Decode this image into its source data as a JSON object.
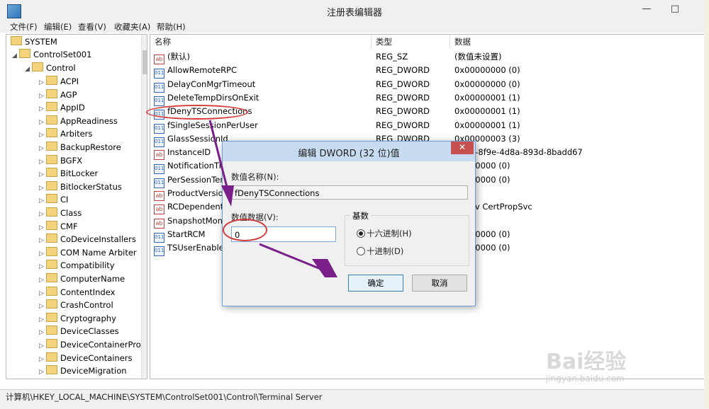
{
  "window": {
    "title": "注册表编辑器",
    "minimize": "—",
    "maximize": "□"
  },
  "menu": [
    "文件(F)",
    "编辑(E)",
    "查看(V)",
    "收藏夹(A)",
    "帮助(H)"
  ],
  "tree": {
    "root": "SYSTEM",
    "level1": "ControlSet001",
    "level2": "Control",
    "children": [
      "ACPI",
      "AGP",
      "AppID",
      "AppReadiness",
      "Arbiters",
      "BackupRestore",
      "BGFX",
      "BitLocker",
      "BitlockerStatus",
      "CI",
      "Class",
      "CMF",
      "CoDeviceInstallers",
      "COM Name Arbiter",
      "Compatibility",
      "ComputerName",
      "ContentIndex",
      "CrashControl",
      "Cryptography",
      "DeviceClasses",
      "DeviceContainerPro",
      "DeviceContainers",
      "DeviceMigration"
    ]
  },
  "columns": {
    "name": "名称",
    "type": "类型",
    "data": "数据"
  },
  "values": [
    {
      "name": "(默认)",
      "type": "REG_SZ",
      "data": "(数值未设置)",
      "icon": "string-value-icon"
    },
    {
      "name": "AllowRemoteRPC",
      "type": "REG_DWORD",
      "data": "0x00000000 (0)",
      "icon": "binary-value-icon"
    },
    {
      "name": "DelayConMgrTimeout",
      "type": "REG_DWORD",
      "data": "0x00000000 (0)",
      "icon": "binary-value-icon"
    },
    {
      "name": "DeleteTempDirsOnExit",
      "type": "REG_DWORD",
      "data": "0x00000001 (1)",
      "icon": "binary-value-icon"
    },
    {
      "name": "fDenyTSConnections",
      "type": "REG_DWORD",
      "data": "0x00000001 (1)",
      "icon": "binary-value-icon"
    },
    {
      "name": "fSingleSessionPerUser",
      "type": "REG_DWORD",
      "data": "0x00000001 (1)",
      "icon": "binary-value-icon"
    },
    {
      "name": "GlassSessionId",
      "type": "REG_DWORD",
      "data": "0x00000003 (3)",
      "icon": "binary-value-icon"
    },
    {
      "name": "InstanceID",
      "type": "",
      "data": "0983-8f9e-4d8a-893d-8badd67",
      "icon": "string-value-icon"
    },
    {
      "name": "NotificationTi",
      "type": "",
      "data": "00000000 (0)",
      "icon": "binary-value-icon"
    },
    {
      "name": "PerSessionTem",
      "type": "",
      "data": "00000000 (0)",
      "icon": "binary-value-icon"
    },
    {
      "name": "ProductVersion",
      "type": "",
      "data": "",
      "icon": "string-value-icon"
    },
    {
      "name": "RCDependentS",
      "type": "",
      "data": "onEnv CertPropSvc",
      "icon": "string-value-icon"
    },
    {
      "name": "SnapshotMonit",
      "type": "",
      "data": "",
      "icon": "string-value-icon"
    },
    {
      "name": "StartRCM",
      "type": "",
      "data": "00000000 (0)",
      "icon": "binary-value-icon"
    },
    {
      "name": "TSUserEnabled",
      "type": "",
      "data": "00000000 (0)",
      "icon": "binary-value-icon"
    }
  ],
  "status": "计算机\\HKEY_LOCAL_MACHINE\\SYSTEM\\ControlSet001\\Control\\Terminal Server",
  "dialog": {
    "title": "编辑 DWORD (32 位)值",
    "close": "✕",
    "name_label": "数值名称(N):",
    "name_value": "fDenyTSConnections",
    "data_label": "数值数据(V):",
    "data_value": "0",
    "base_label": "基数",
    "hex_label": "十六进制(H)",
    "dec_label": "十进制(D)",
    "ok": "确定",
    "cancel": "取消"
  },
  "watermark": {
    "brand": "Bai经验",
    "url": "jingyan.baidu.com"
  },
  "colors": {
    "annotation": "#d43a3a",
    "arrow": "#7a1f8a",
    "accent": "#3c7fb1"
  }
}
